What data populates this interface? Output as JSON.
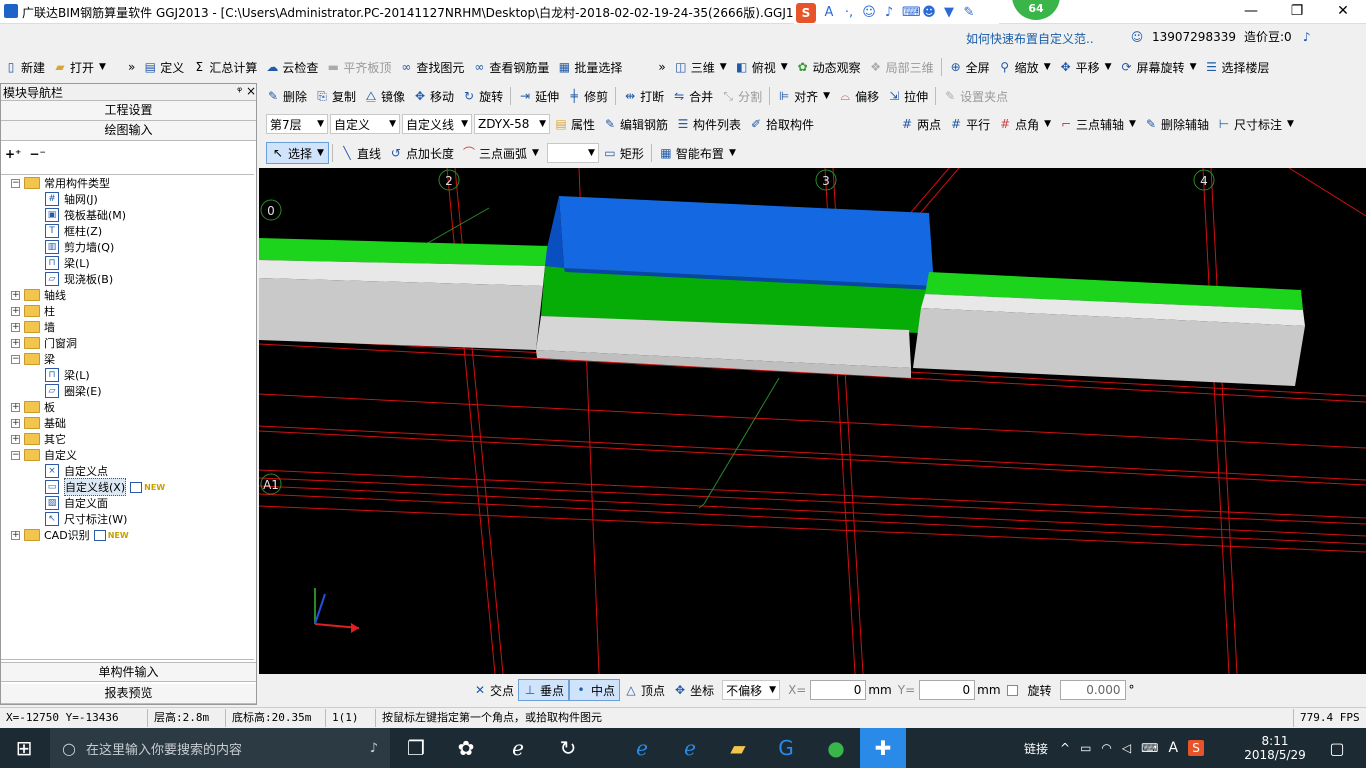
{
  "window": {
    "title": "广联达BIM钢筋算量软件 GGJ2013 - [C:\\Users\\Administrator.PC-20141127NRHM\\Desktop\\白龙村-2018-02-02-19-24-35(2666版).GGJ12]",
    "badge": "64",
    "hint_link": "如何快速布置自定义范..",
    "phone": "13907298339",
    "beans": "造价豆:0"
  },
  "toolbar1": {
    "new": "新建",
    "open": "打开",
    "define": "定义",
    "sum": "汇总计算",
    "cloud_check": "云检查",
    "flat_top": "平齐板顶",
    "find": "查找图元",
    "view_rebar": "查看钢筋量",
    "batch_select": "批量选择",
    "three_d": "三维",
    "top_view": "俯视",
    "dynamic": "动态观察",
    "local_3d": "局部三维",
    "fullscreen": "全屏",
    "zoom": "缩放",
    "pan": "平移",
    "screen_rotate": "屏幕旋转",
    "select_floor": "选择楼层"
  },
  "toolbar2": {
    "delete": "删除",
    "copy": "复制",
    "mirror": "镜像",
    "move": "移动",
    "rotate": "旋转",
    "extend": "延伸",
    "trim": "修剪",
    "break": "打断",
    "merge": "合并",
    "split": "分割",
    "align": "对齐",
    "offset": "偏移",
    "stretch": "拉伸",
    "set_grip": "设置夹点"
  },
  "toolbar3": {
    "floor": "第7层",
    "category": "自定义",
    "type": "自定义线",
    "element": "ZDYX-58",
    "property": "属性",
    "edit_rebar": "编辑钢筋",
    "element_list": "构件列表",
    "pick": "拾取构件",
    "two_point": "两点",
    "parallel": "平行",
    "angle": "点角",
    "three_point_aux": "三点辅轴",
    "delete_aux": "删除辅轴",
    "dimension": "尺寸标注"
  },
  "toolbar4": {
    "select": "选择",
    "line": "直线",
    "point_length": "点加长度",
    "three_point_arc": "三点画弧",
    "rect": "矩形",
    "smart_layout": "智能布置"
  },
  "panel": {
    "title": "模块导航栏",
    "pin": "ᵠ ×",
    "btn_project": "工程设置",
    "btn_drawing": "绘图输入",
    "btn_single": "单构件输入",
    "btn_report": "报表预览",
    "tree": [
      {
        "label": "常用构件类型",
        "level": 0,
        "kind": "folder",
        "exp": "−"
      },
      {
        "label": "轴网(J)",
        "level": 1,
        "kind": "leaf",
        "ic": "#"
      },
      {
        "label": "筏板基础(M)",
        "level": 1,
        "kind": "leaf",
        "ic": "▣"
      },
      {
        "label": "框柱(Z)",
        "level": 1,
        "kind": "leaf",
        "ic": "T"
      },
      {
        "label": "剪力墙(Q)",
        "level": 1,
        "kind": "leaf",
        "ic": "▥"
      },
      {
        "label": "梁(L)",
        "level": 1,
        "kind": "leaf",
        "ic": "⊓"
      },
      {
        "label": "现浇板(B)",
        "level": 1,
        "kind": "leaf",
        "ic": "▱"
      },
      {
        "label": "轴线",
        "level": 0,
        "kind": "folder",
        "exp": "+"
      },
      {
        "label": "柱",
        "level": 0,
        "kind": "folder",
        "exp": "+"
      },
      {
        "label": "墙",
        "level": 0,
        "kind": "folder",
        "exp": "+"
      },
      {
        "label": "门窗洞",
        "level": 0,
        "kind": "folder",
        "exp": "+"
      },
      {
        "label": "梁",
        "level": 0,
        "kind": "folder",
        "exp": "−"
      },
      {
        "label": "梁(L)",
        "level": 1,
        "kind": "leaf",
        "ic": "⊓"
      },
      {
        "label": "圈梁(E)",
        "level": 1,
        "kind": "leaf",
        "ic": "▱"
      },
      {
        "label": "板",
        "level": 0,
        "kind": "folder",
        "exp": "+"
      },
      {
        "label": "基础",
        "level": 0,
        "kind": "folder",
        "exp": "+"
      },
      {
        "label": "其它",
        "level": 0,
        "kind": "folder",
        "exp": "+"
      },
      {
        "label": "自定义",
        "level": 0,
        "kind": "folder",
        "exp": "−"
      },
      {
        "label": "自定义点",
        "level": 1,
        "kind": "leaf",
        "ic": "×"
      },
      {
        "label": "自定义线(X)",
        "level": 1,
        "kind": "leaf",
        "ic": "▭",
        "new": "NEW",
        "selected": true
      },
      {
        "label": "自定义面",
        "level": 1,
        "kind": "leaf",
        "ic": "▨"
      },
      {
        "label": "尺寸标注(W)",
        "level": 1,
        "kind": "leaf",
        "ic": "↖"
      },
      {
        "label": "CAD识别",
        "level": 0,
        "kind": "folder",
        "exp": "+",
        "new": "NEW"
      }
    ]
  },
  "viewport": {
    "axis_labels": [
      "2",
      "3",
      "4",
      "0",
      "A1"
    ]
  },
  "bottombar": {
    "intersect": "交点",
    "perp": "垂点",
    "mid": "中点",
    "vertex": "顶点",
    "coord": "坐标",
    "offset_mode": "不偏移",
    "x_label": "X=",
    "x_val": "0",
    "mm1": "mm",
    "y_label": "Y=",
    "y_val": "0",
    "mm2": "mm",
    "rotate_label": "旋转",
    "rotate_val": "0.000",
    "deg": "°"
  },
  "status": {
    "coords": "X=-12750 Y=-13436",
    "floor_height": "层高:2.8m",
    "base_height": "底标高:20.35m",
    "count": "1(1)",
    "message": "按鼠标左键指定第一个角点，或拾取构件图元",
    "fps": "779.4 FPS"
  },
  "taskbar": {
    "search_placeholder": "在这里输入你要搜索的内容",
    "link": "链接",
    "ime": "A",
    "time": "8:11",
    "date": "2018/5/29"
  }
}
